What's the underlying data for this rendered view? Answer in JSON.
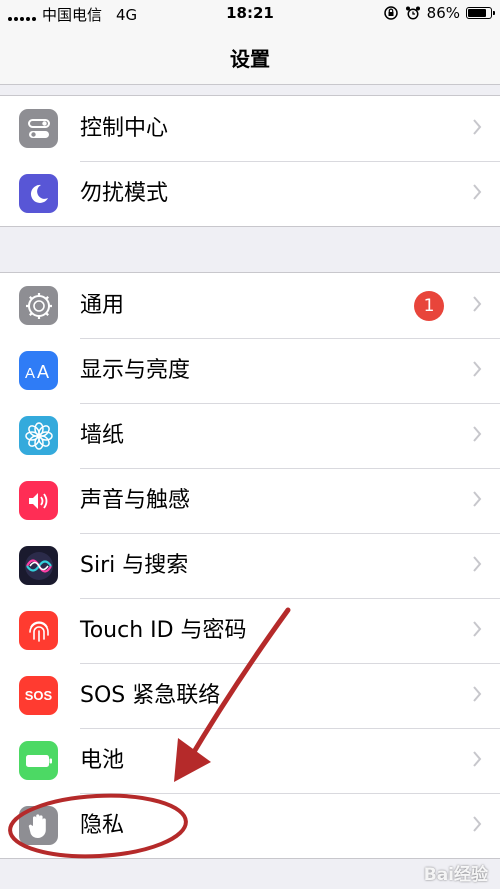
{
  "status_bar": {
    "carrier": "中国电信",
    "network": "4G",
    "time": "18:21",
    "battery_percent": "86%",
    "battery_level": 0.86
  },
  "nav": {
    "title": "设置"
  },
  "groups": [
    {
      "items": [
        {
          "label": "控制中心",
          "icon": "control-center-icon",
          "color": "#8e8e93"
        },
        {
          "label": "勿扰模式",
          "icon": "moon-icon",
          "color": "#5856d6"
        }
      ]
    },
    {
      "items": [
        {
          "label": "通用",
          "icon": "gear-icon",
          "color": "#8e8e93",
          "badge": "1"
        },
        {
          "label": "显示与亮度",
          "icon": "text-size-icon",
          "color": "#2f7cf6"
        },
        {
          "label": "墙纸",
          "icon": "flower-icon",
          "color": "#34aadc"
        },
        {
          "label": "声音与触感",
          "icon": "speaker-icon",
          "color": "#ff2d55"
        },
        {
          "label": "Siri 与搜索",
          "icon": "siri-icon",
          "color": "#1a1a2e"
        },
        {
          "label": "Touch ID 与密码",
          "icon": "fingerprint-icon",
          "color": "#ff3b30"
        },
        {
          "label": "SOS 紧急联络",
          "icon": "sos-icon",
          "color": "#ff3b30",
          "icon_text": "SOS"
        },
        {
          "label": "电池",
          "icon": "battery-icon",
          "color": "#4cd964"
        },
        {
          "label": "隐私",
          "icon": "hand-icon",
          "color": "#8e8e93"
        }
      ]
    }
  ],
  "annotation": {
    "color": "#b52a2a"
  },
  "watermark": "Bai经验"
}
